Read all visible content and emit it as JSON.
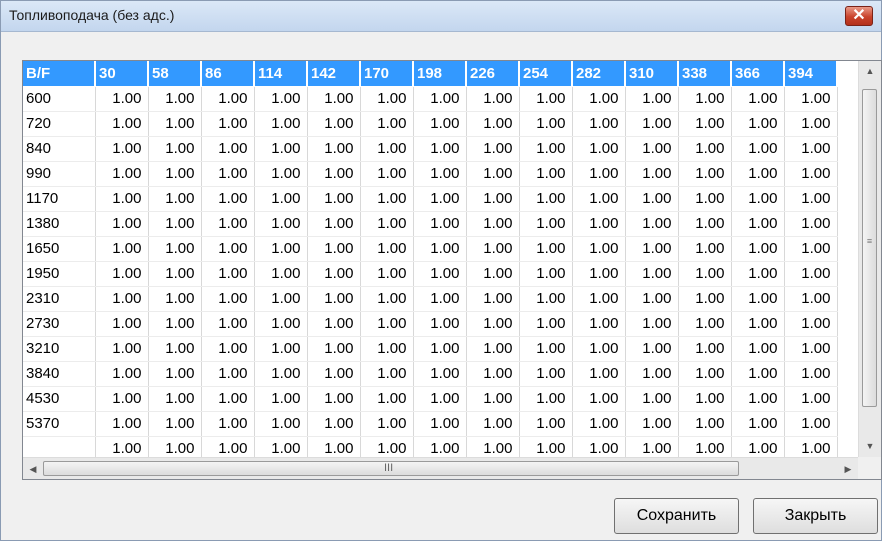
{
  "window": {
    "title": "Топливоподача (без адс.)",
    "close_glyph": "✕"
  },
  "table": {
    "corner_header": "B/F",
    "column_headers": [
      "30",
      "58",
      "86",
      "114",
      "142",
      "170",
      "198",
      "226",
      "254",
      "282",
      "310",
      "338",
      "366",
      "394"
    ],
    "rows": [
      {
        "label": "600",
        "values": [
          "1.00",
          "1.00",
          "1.00",
          "1.00",
          "1.00",
          "1.00",
          "1.00",
          "1.00",
          "1.00",
          "1.00",
          "1.00",
          "1.00",
          "1.00",
          "1.00"
        ]
      },
      {
        "label": "720",
        "values": [
          "1.00",
          "1.00",
          "1.00",
          "1.00",
          "1.00",
          "1.00",
          "1.00",
          "1.00",
          "1.00",
          "1.00",
          "1.00",
          "1.00",
          "1.00",
          "1.00"
        ]
      },
      {
        "label": "840",
        "values": [
          "1.00",
          "1.00",
          "1.00",
          "1.00",
          "1.00",
          "1.00",
          "1.00",
          "1.00",
          "1.00",
          "1.00",
          "1.00",
          "1.00",
          "1.00",
          "1.00"
        ]
      },
      {
        "label": "990",
        "values": [
          "1.00",
          "1.00",
          "1.00",
          "1.00",
          "1.00",
          "1.00",
          "1.00",
          "1.00",
          "1.00",
          "1.00",
          "1.00",
          "1.00",
          "1.00",
          "1.00"
        ]
      },
      {
        "label": "1170",
        "values": [
          "1.00",
          "1.00",
          "1.00",
          "1.00",
          "1.00",
          "1.00",
          "1.00",
          "1.00",
          "1.00",
          "1.00",
          "1.00",
          "1.00",
          "1.00",
          "1.00"
        ]
      },
      {
        "label": "1380",
        "values": [
          "1.00",
          "1.00",
          "1.00",
          "1.00",
          "1.00",
          "1.00",
          "1.00",
          "1.00",
          "1.00",
          "1.00",
          "1.00",
          "1.00",
          "1.00",
          "1.00"
        ]
      },
      {
        "label": "1650",
        "values": [
          "1.00",
          "1.00",
          "1.00",
          "1.00",
          "1.00",
          "1.00",
          "1.00",
          "1.00",
          "1.00",
          "1.00",
          "1.00",
          "1.00",
          "1.00",
          "1.00"
        ]
      },
      {
        "label": "1950",
        "values": [
          "1.00",
          "1.00",
          "1.00",
          "1.00",
          "1.00",
          "1.00",
          "1.00",
          "1.00",
          "1.00",
          "1.00",
          "1.00",
          "1.00",
          "1.00",
          "1.00"
        ]
      },
      {
        "label": "2310",
        "values": [
          "1.00",
          "1.00",
          "1.00",
          "1.00",
          "1.00",
          "1.00",
          "1.00",
          "1.00",
          "1.00",
          "1.00",
          "1.00",
          "1.00",
          "1.00",
          "1.00"
        ]
      },
      {
        "label": "2730",
        "values": [
          "1.00",
          "1.00",
          "1.00",
          "1.00",
          "1.00",
          "1.00",
          "1.00",
          "1.00",
          "1.00",
          "1.00",
          "1.00",
          "1.00",
          "1.00",
          "1.00"
        ]
      },
      {
        "label": "3210",
        "values": [
          "1.00",
          "1.00",
          "1.00",
          "1.00",
          "1.00",
          "1.00",
          "1.00",
          "1.00",
          "1.00",
          "1.00",
          "1.00",
          "1.00",
          "1.00",
          "1.00"
        ]
      },
      {
        "label": "3840",
        "values": [
          "1.00",
          "1.00",
          "1.00",
          "1.00",
          "1.00",
          "1.00",
          "1.00",
          "1.00",
          "1.00",
          "1.00",
          "1.00",
          "1.00",
          "1.00",
          "1.00"
        ]
      },
      {
        "label": "4530",
        "values": [
          "1.00",
          "1.00",
          "1.00",
          "1.00",
          "1.00",
          "1.00",
          "1.00",
          "1.00",
          "1.00",
          "1.00",
          "1.00",
          "1.00",
          "1.00",
          "1.00"
        ]
      },
      {
        "label": "5370",
        "values": [
          "1.00",
          "1.00",
          "1.00",
          "1.00",
          "1.00",
          "1.00",
          "1.00",
          "1.00",
          "1.00",
          "1.00",
          "1.00",
          "1.00",
          "1.00",
          "1.00"
        ]
      },
      {
        "label": "",
        "values": [
          "1.00",
          "1.00",
          "1.00",
          "1.00",
          "1.00",
          "1.00",
          "1.00",
          "1.00",
          "1.00",
          "1.00",
          "1.00",
          "1.00",
          "1.00",
          "1.00"
        ]
      }
    ]
  },
  "scrollbars": {
    "up_arrow": "▲",
    "down_arrow": "▼",
    "left_arrow": "◀",
    "right_arrow": "▶",
    "v_grip": "≡",
    "h_grip": "III"
  },
  "buttons": {
    "save": "Сохранить",
    "close": "Закрыть"
  },
  "colors": {
    "header_bg": "#3399ff",
    "header_text": "#ffffff",
    "close_button": "#c9432c"
  }
}
